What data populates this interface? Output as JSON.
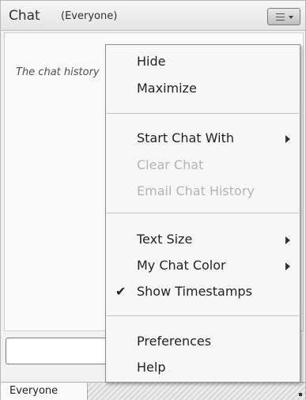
{
  "pod": {
    "title": "Chat",
    "subtitle": "(Everyone)",
    "history_text": "The chat history",
    "menu_button_icon": "hamburger-dropdown-icon"
  },
  "tabs": [
    {
      "label": "Everyone"
    }
  ],
  "menu": {
    "items": {
      "hide": {
        "label": "Hide"
      },
      "maximize": {
        "label": "Maximize"
      },
      "start_chat_with": {
        "label": "Start Chat With",
        "submenu": true
      },
      "clear_chat": {
        "label": "Clear Chat",
        "disabled": true
      },
      "email_chat_history": {
        "label": "Email Chat History",
        "disabled": true
      },
      "text_size": {
        "label": "Text Size",
        "submenu": true
      },
      "my_chat_color": {
        "label": "My Chat Color",
        "submenu": true
      },
      "show_timestamps": {
        "label": "Show Timestamps",
        "checked": true,
        "check_glyph": "✔"
      },
      "preferences": {
        "label": "Preferences"
      },
      "help": {
        "label": "Help"
      }
    }
  },
  "colors": {
    "disabled_text": "#b4b4b4",
    "menu_bg": "#f7f7f7",
    "header_bg": "#e4e4e4"
  }
}
